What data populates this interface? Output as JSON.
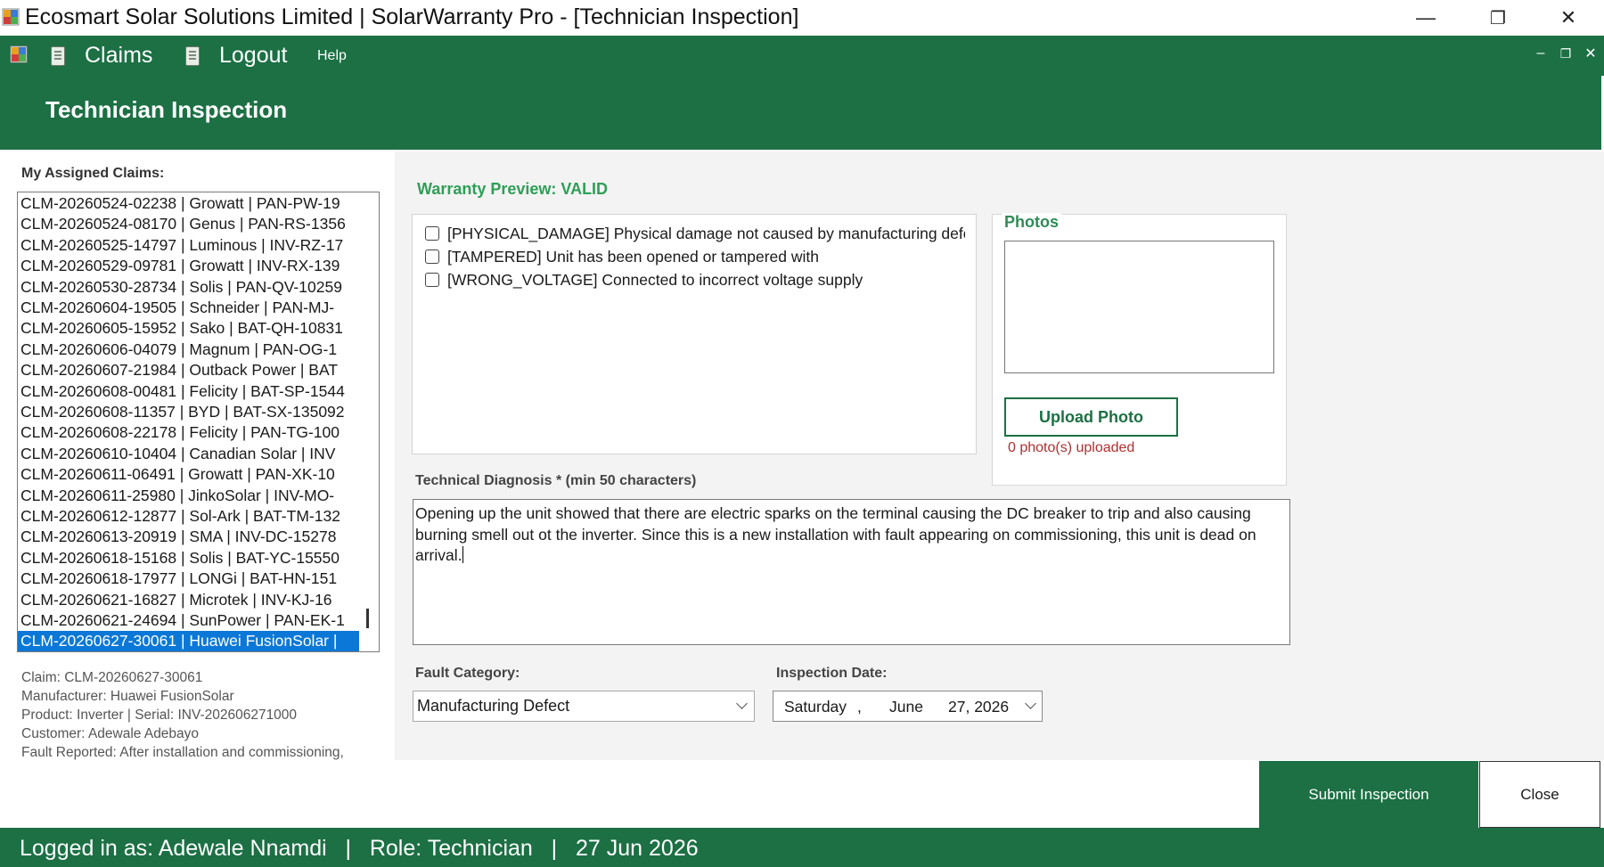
{
  "window": {
    "title": "Ecosmart Solar Solutions Limited | SolarWarranty Pro - [Technician Inspection]",
    "controls": {
      "minimize": "—",
      "restore": "❐",
      "close": "✕"
    }
  },
  "menu": {
    "claims": "Claims",
    "logout": "Logout",
    "help": "Help",
    "mdi_controls": {
      "minimize": "–",
      "restore": "❐",
      "close": "✕"
    }
  },
  "header": {
    "title": "Technician Inspection"
  },
  "assigned": {
    "label": "My Assigned Claims:",
    "claims": [
      "CLM-20260524-02238  |  Growatt  |  PAN-PW-19",
      "CLM-20260524-08170  |  Genus  |  PAN-RS-1356",
      "CLM-20260525-14797  |  Luminous  |  INV-RZ-17",
      "CLM-20260529-09781  |  Growatt  |  INV-RX-139",
      "CLM-20260530-28734  |  Solis  |  PAN-QV-10259",
      "CLM-20260604-19505  |  Schneider  |  PAN-MJ-",
      "CLM-20260605-15952  |  Sako  |  BAT-QH-10831",
      "CLM-20260606-04079  |  Magnum  |  PAN-OG-1",
      "CLM-20260607-21984  |  Outback Power  |  BAT",
      "CLM-20260608-00481  |  Felicity  |  BAT-SP-1544",
      "CLM-20260608-11357  |  BYD  |  BAT-SX-135092",
      "CLM-20260608-22178  |  Felicity  |  PAN-TG-100",
      "CLM-20260610-10404  |  Canadian Solar  |  INV",
      "CLM-20260611-06491  |  Growatt  |  PAN-XK-10",
      "CLM-20260611-25980  |  JinkoSolar  |  INV-MO-",
      "CLM-20260612-12877  |  Sol-Ark  |  BAT-TM-132",
      "CLM-20260613-20919  |  SMA  |  INV-DC-15278",
      "CLM-20260618-15168  |  Solis  |  BAT-YC-15550",
      "CLM-20260618-17977  |  LONGi  |  BAT-HN-151",
      "CLM-20260621-16827  |  Microtek  |  INV-KJ-16",
      "CLM-20260621-24694  |  SunPower  |  PAN-EK-1",
      "CLM-20260627-30061  |  Huawei FusionSolar  |"
    ],
    "selected_index": 21
  },
  "claim_info": {
    "claim": "Claim: CLM-20260627-30061",
    "manufacturer": "Manufacturer: Huawei FusionSolar",
    "product": "Product: Inverter  |  Serial: INV-202606271000",
    "customer": "Customer: Adewale Adebayo",
    "fault": "Fault Reported: After installation and commissioning,"
  },
  "warranty": {
    "preview": "Warranty Preview:  VALID"
  },
  "conditions": [
    {
      "text": "[PHYSICAL_DAMAGE] Physical damage not caused by manufacturing defect",
      "checked": false
    },
    {
      "text": "[TAMPERED] Unit has been opened or tampered with",
      "checked": false
    },
    {
      "text": "[WRONG_VOLTAGE] Connected to incorrect voltage supply",
      "checked": false
    }
  ],
  "photos": {
    "label": "Photos",
    "upload_button": "Upload Photo",
    "count_text": "0 photo(s) uploaded"
  },
  "diagnosis": {
    "label": "Technical Diagnosis *  (min 50 characters)",
    "value": "Opening up the unit showed that there are electric sparks on the terminal causing the DC breaker to trip and also causing burning smell out ot the inverter. Since this is a new installation with fault appearing on commissioning, this unit is dead on arrival."
  },
  "fault_category": {
    "label": "Fault Category:",
    "value": "Manufacturing Defect"
  },
  "inspection_date": {
    "label": "Inspection Date:",
    "day": "Saturday",
    "sep": ",",
    "month": "June",
    "date": "27, 2026"
  },
  "buttons": {
    "submit": "Submit Inspection",
    "close": "Close"
  },
  "status": {
    "text": "Logged in as: Adewale Nnamdi   |   Role: Technician   |   27 Jun 2026"
  },
  "colors": {
    "brand_green": "#1c7044",
    "valid_green": "#2f9e57",
    "selection_blue": "#0b78d7",
    "warning_red": "#b03030"
  }
}
